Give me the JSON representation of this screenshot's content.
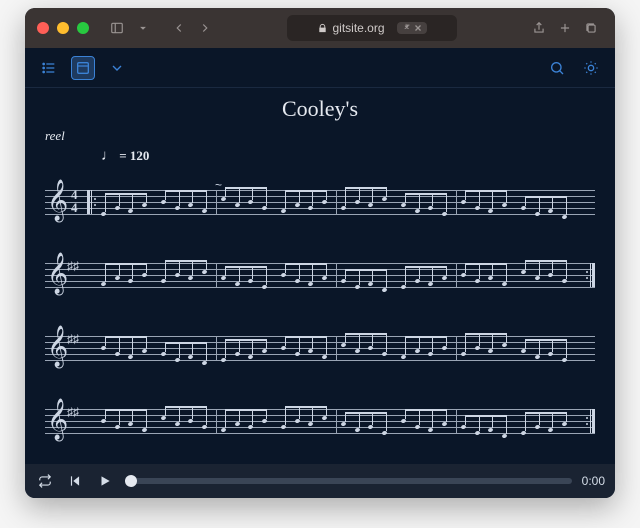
{
  "browser": {
    "url_host": "gitsite.org",
    "traffic": [
      "close",
      "minimize",
      "zoom"
    ]
  },
  "app_toolbar": {
    "items": [
      "list-view",
      "page-view",
      "expand"
    ],
    "right_items": [
      "search",
      "theme"
    ]
  },
  "score": {
    "title": "Cooley's",
    "subtitle": "reel",
    "tempo_bpm": "120",
    "tempo_unit": "♩",
    "key": "D",
    "time_sig_top": "4",
    "time_sig_bot": "4",
    "staves": 4
  },
  "player": {
    "time": "0:00",
    "progress": 0
  }
}
